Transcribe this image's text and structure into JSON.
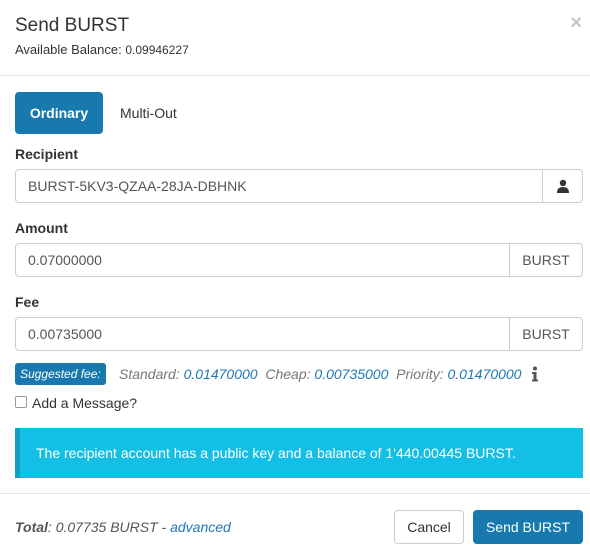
{
  "header": {
    "title": "Send BURST",
    "balance_label": "Available Balance: ",
    "balance_value": "0.09946227",
    "close_glyph": "×"
  },
  "tabs": [
    {
      "label": "Ordinary",
      "active": true
    },
    {
      "label": "Multi-Out",
      "active": false
    }
  ],
  "recipient": {
    "label": "Recipient",
    "value": "BURST-5KV3-QZAA-28JA-DBHNK",
    "icon": "user-icon"
  },
  "amount": {
    "label": "Amount",
    "value": "0.07000000",
    "unit": "BURST"
  },
  "fee": {
    "label": "Fee",
    "value": "0.00735000",
    "unit": "BURST",
    "suggested_label": "Suggested fee:",
    "standard_label": "Standard:",
    "standard_value": "0.01470000",
    "cheap_label": "Cheap:",
    "cheap_value": "0.00735000",
    "priority_label": "Priority:",
    "priority_value": "0.01470000",
    "info_icon": "info-icon"
  },
  "message": {
    "label": "Add a Message?",
    "checked": false
  },
  "alert": {
    "text": "The recipient account has a public key and a balance of 1'440.00445 BURST."
  },
  "footer": {
    "total_label": "Total",
    "total_value": ": 0.07735 BURST - ",
    "advanced_label": "advanced",
    "cancel_label": "Cancel",
    "send_label": "Send BURST"
  },
  "colors": {
    "primary": "#1779ae",
    "alert_bg": "#14bfe6",
    "alert_border": "#119ec0",
    "link": "#1f77b4"
  }
}
